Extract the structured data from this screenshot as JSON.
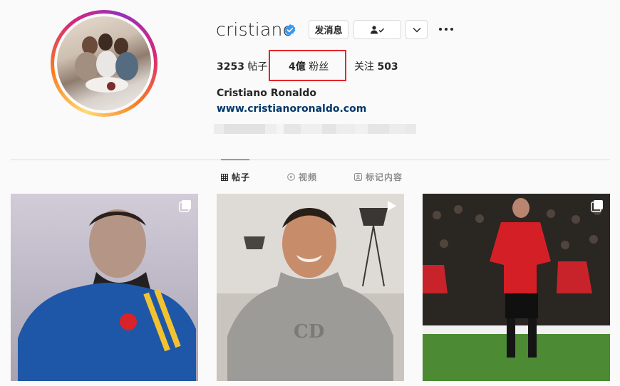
{
  "profile": {
    "username": "cristiano",
    "verified": true,
    "full_name": "Cristiano Ronaldo",
    "website": "www.cristianoronaldo.com"
  },
  "actions": {
    "message_label": "发消息",
    "follow_icon": "person-check-icon",
    "dropdown_icon": "chevron-down-icon",
    "more_icon": "more-dots-icon"
  },
  "stats": {
    "posts_count": "3253",
    "posts_label": "帖子",
    "followers_count": "4億",
    "followers_label": "粉丝",
    "following_label": "关注",
    "following_count": "503"
  },
  "tabs": [
    {
      "label": "帖子",
      "icon": "grid-icon",
      "active": true
    },
    {
      "label": "视频",
      "icon": "play-circle-icon",
      "active": false
    },
    {
      "label": "标记内容",
      "icon": "tag-icon",
      "active": false
    }
  ],
  "posts": [
    {
      "type": "carousel",
      "icon": "carousel-icon"
    },
    {
      "type": "video",
      "icon": "play-icon"
    },
    {
      "type": "carousel",
      "icon": "carousel-icon"
    }
  ],
  "colors": {
    "highlight": "#e3262a",
    "link": "#00376b",
    "verified": "#3897f0"
  }
}
